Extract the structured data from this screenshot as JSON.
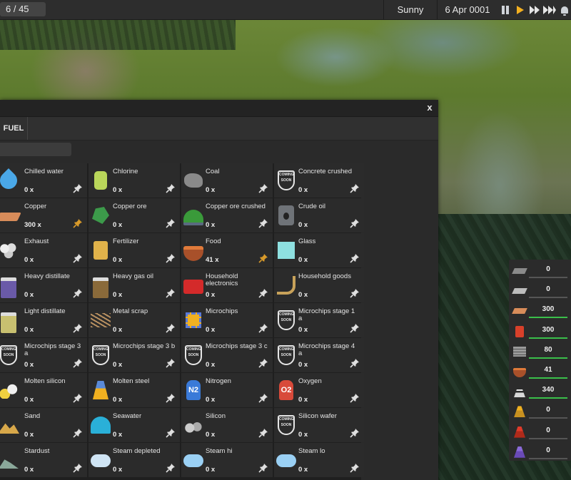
{
  "topbar": {
    "counter": "6 / 45",
    "weather": "Sunny",
    "date": "6 Apr 0001"
  },
  "panel": {
    "close_label": "x",
    "tab_label": "FUEL",
    "search_placeholder": ""
  },
  "products": [
    {
      "name": "Chilled water",
      "qty": "0 x",
      "icon": "water-drop-icon",
      "pinned": false
    },
    {
      "name": "Chlorine",
      "qty": "0 x",
      "icon": "gas-canister-icon",
      "pinned": false
    },
    {
      "name": "Coal",
      "qty": "0 x",
      "icon": "coal-icon",
      "pinned": false
    },
    {
      "name": "Concrete crushed",
      "qty": "0 x",
      "icon": "coming-soon-icon",
      "pinned": false
    },
    {
      "name": "Copper",
      "qty": "300 x",
      "icon": "copper-plank-icon",
      "pinned": true
    },
    {
      "name": "Copper ore",
      "qty": "0 x",
      "icon": "copper-ore-icon",
      "pinned": false
    },
    {
      "name": "Copper ore crushed",
      "qty": "0 x",
      "icon": "ore-cart-icon",
      "pinned": false
    },
    {
      "name": "Crude oil",
      "qty": "0 x",
      "icon": "oil-barrel-icon",
      "pinned": false
    },
    {
      "name": "Exhaust",
      "qty": "0 x",
      "icon": "smoke-icon",
      "pinned": false
    },
    {
      "name": "Fertilizer",
      "qty": "0 x",
      "icon": "fertilizer-icon",
      "pinned": false
    },
    {
      "name": "Food",
      "qty": "41 x",
      "icon": "food-bowl-icon",
      "pinned": true
    },
    {
      "name": "Glass",
      "qty": "0 x",
      "icon": "glass-icon",
      "pinned": false
    },
    {
      "name": "Heavy distillate",
      "qty": "0 x",
      "icon": "distillate-jar-icon",
      "pinned": false
    },
    {
      "name": "Heavy gas oil",
      "qty": "0 x",
      "icon": "gas-oil-jar-icon",
      "pinned": false
    },
    {
      "name": "Household electronics",
      "qty": "0 x",
      "icon": "radio-icon",
      "pinned": false
    },
    {
      "name": "Household goods",
      "qty": "0 x",
      "icon": "rocking-chair-icon",
      "pinned": false
    },
    {
      "name": "Light distillate",
      "qty": "0 x",
      "icon": "light-distillate-icon",
      "pinned": false
    },
    {
      "name": "Metal scrap",
      "qty": "0 x",
      "icon": "scrap-icon",
      "pinned": false
    },
    {
      "name": "Microchips",
      "qty": "0 x",
      "icon": "microchip-icon",
      "pinned": false
    },
    {
      "name": "Microchips stage 1 a",
      "qty": "0 x",
      "icon": "coming-soon-icon",
      "pinned": false
    },
    {
      "name": "Microchips stage 3 a",
      "qty": "0 x",
      "icon": "coming-soon-icon",
      "pinned": false
    },
    {
      "name": "Microchips stage 3 b",
      "qty": "0 x",
      "icon": "coming-soon-icon",
      "pinned": false
    },
    {
      "name": "Microchips stage 3 c",
      "qty": "0 x",
      "icon": "coming-soon-icon",
      "pinned": false
    },
    {
      "name": "Microchips stage 4 a",
      "qty": "0 x",
      "icon": "coming-soon-icon",
      "pinned": false
    },
    {
      "name": "Molten silicon",
      "qty": "0 x",
      "icon": "molten-silicon-icon",
      "pinned": false
    },
    {
      "name": "Molten steel",
      "qty": "0 x",
      "icon": "molten-steel-icon",
      "pinned": false
    },
    {
      "name": "Nitrogen",
      "qty": "0 x",
      "icon": "nitrogen-tank-icon",
      "pinned": false
    },
    {
      "name": "Oxygen",
      "qty": "0 x",
      "icon": "oxygen-tank-icon",
      "pinned": false
    },
    {
      "name": "Sand",
      "qty": "0 x",
      "icon": "sand-icon",
      "pinned": false
    },
    {
      "name": "Seawater",
      "qty": "0 x",
      "icon": "wave-icon",
      "pinned": false
    },
    {
      "name": "Silicon",
      "qty": "0 x",
      "icon": "silicon-pebble-icon",
      "pinned": false
    },
    {
      "name": "Silicon wafer",
      "qty": "0 x",
      "icon": "coming-soon-icon",
      "pinned": false
    },
    {
      "name": "Stardust",
      "qty": "0 x",
      "icon": "stardust-icon",
      "pinned": false
    },
    {
      "name": "Steam depleted",
      "qty": "0 x",
      "icon": "steam-cloud-icon",
      "pinned": false
    },
    {
      "name": "Steam hi",
      "qty": "0 x",
      "icon": "steam-hi-icon",
      "pinned": false
    },
    {
      "name": "Steam lo",
      "qty": "0 x",
      "icon": "steam-lo-icon",
      "pinned": false
    }
  ],
  "coming_soon_badge": "COMING SOON",
  "nitrogen_symbol": "N2",
  "oxygen_symbol": "O2",
  "resources": [
    {
      "value": "0",
      "icon": "iron-plate-icon",
      "fill": 0
    },
    {
      "value": "0",
      "icon": "steel-plate-icon",
      "fill": 0
    },
    {
      "value": "300",
      "icon": "copper-plank-icon",
      "fill": 1
    },
    {
      "value": "300",
      "icon": "fuel-can-icon",
      "fill": 1
    },
    {
      "value": "80",
      "icon": "metal-stack-icon",
      "fill": 1
    },
    {
      "value": "41",
      "icon": "food-bowl-icon",
      "fill": 1
    },
    {
      "value": "340",
      "icon": "workers-tower-icon",
      "fill": 1
    },
    {
      "value": "0",
      "icon": "unity-yellow-icon",
      "fill": 0
    },
    {
      "value": "0",
      "icon": "unity-red-icon",
      "fill": 0
    },
    {
      "value": "0",
      "icon": "unity-purple-icon",
      "fill": 0
    }
  ],
  "colors": {
    "accent_orange": "#f3b020",
    "pin_active": "#d89a2a",
    "bar_green": "#3abf4a"
  }
}
